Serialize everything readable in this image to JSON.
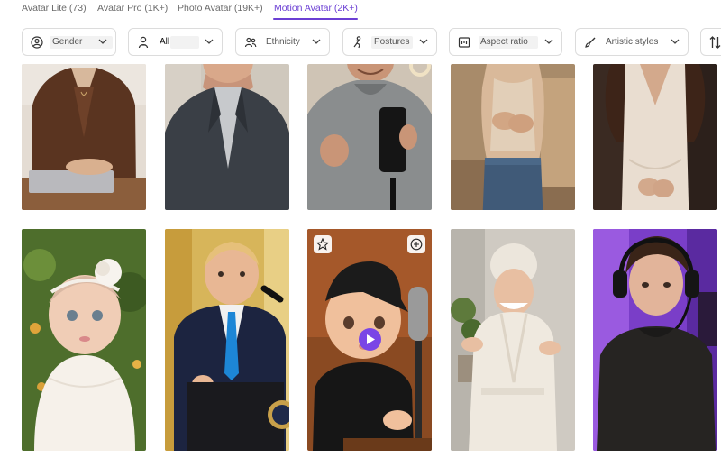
{
  "tabs": [
    {
      "label": "Avatar Lite (73)",
      "active": false
    },
    {
      "label": "Avatar Pro (1K+)",
      "active": false
    },
    {
      "label": "Photo Avatar (19K+)",
      "active": false
    },
    {
      "label": "Motion Avatar (2K+)",
      "active": true
    }
  ],
  "filters": {
    "gender": {
      "label": "Gender",
      "icon": "user-circle-icon"
    },
    "age": {
      "value": "All",
      "icon": "baby-face-icon"
    },
    "ethnicity": {
      "label": "Ethnicity",
      "icon": "people-icon"
    },
    "postures": {
      "label": "Postures",
      "icon": "posture-icon"
    },
    "aspect_ratio": {
      "label": "Aspect ratio",
      "icon": "aspect-ratio-icon"
    },
    "artistic_styles": {
      "label": "Artistic styles",
      "icon": "brush-icon"
    }
  },
  "sort": {
    "icon": "sort-arrows-icon"
  },
  "avatars": [
    {
      "name": "woman-brown-blazer-laptop",
      "row": 1
    },
    {
      "name": "man-gray-suit",
      "row": 1
    },
    {
      "name": "man-gray-hoodie-phone-tripod",
      "row": 1
    },
    {
      "name": "woman-tan-tank-top-jeans",
      "row": 1
    },
    {
      "name": "woman-cream-dress",
      "row": 1
    },
    {
      "name": "baby-girl-white-headband",
      "row": 2
    },
    {
      "name": "toddler-in-suit-podium",
      "row": 2
    },
    {
      "name": "baby-black-cap-microphone",
      "row": 2,
      "hovered": true
    },
    {
      "name": "woman-bathrobe-towel",
      "row": 2
    },
    {
      "name": "young-man-headphones-purple",
      "row": 2
    }
  ],
  "colors": {
    "accent": "#6b3fd4",
    "play_button": "#7a45e6"
  }
}
